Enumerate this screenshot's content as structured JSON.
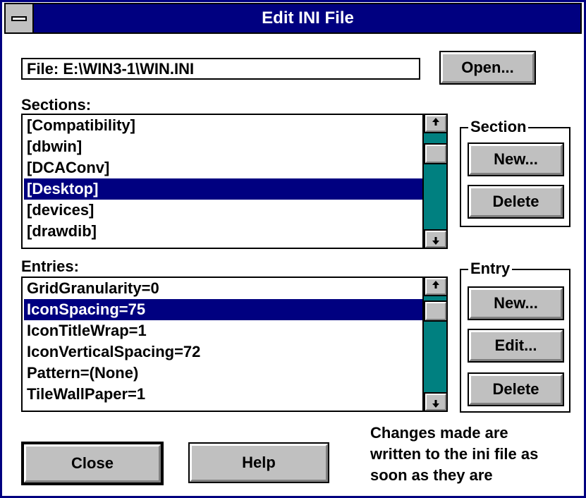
{
  "window": {
    "title": "Edit INI File"
  },
  "file": {
    "value": "File: E:\\WIN3-1\\WIN.INI",
    "open_label": "Open..."
  },
  "sections": {
    "label": "Sections:",
    "items": [
      "[Compatibility]",
      "[dbwin]",
      "[DCAConv]",
      "[Desktop]",
      "[devices]",
      "[drawdib]"
    ],
    "selected_index": 3
  },
  "section_group": {
    "label": "Section",
    "new_label": "New...",
    "delete_label": "Delete"
  },
  "entries": {
    "label": "Entries:",
    "items": [
      "GridGranularity=0",
      "IconSpacing=75",
      "IconTitleWrap=1",
      "IconVerticalSpacing=72",
      "Pattern=(None)",
      "TileWallPaper=1"
    ],
    "selected_index": 1
  },
  "entry_group": {
    "label": "Entry",
    "new_label": "New...",
    "edit_label": "Edit...",
    "delete_label": "Delete"
  },
  "footer": {
    "close_label": "Close",
    "help_label": "Help",
    "note_lines": [
      "Changes made are",
      "written to the ini file as",
      "soon as they are"
    ]
  },
  "colors": {
    "title_bar": "#000080",
    "selection": "#000080",
    "scroll_track": "#008080",
    "button_face": "#c0c0c0"
  }
}
